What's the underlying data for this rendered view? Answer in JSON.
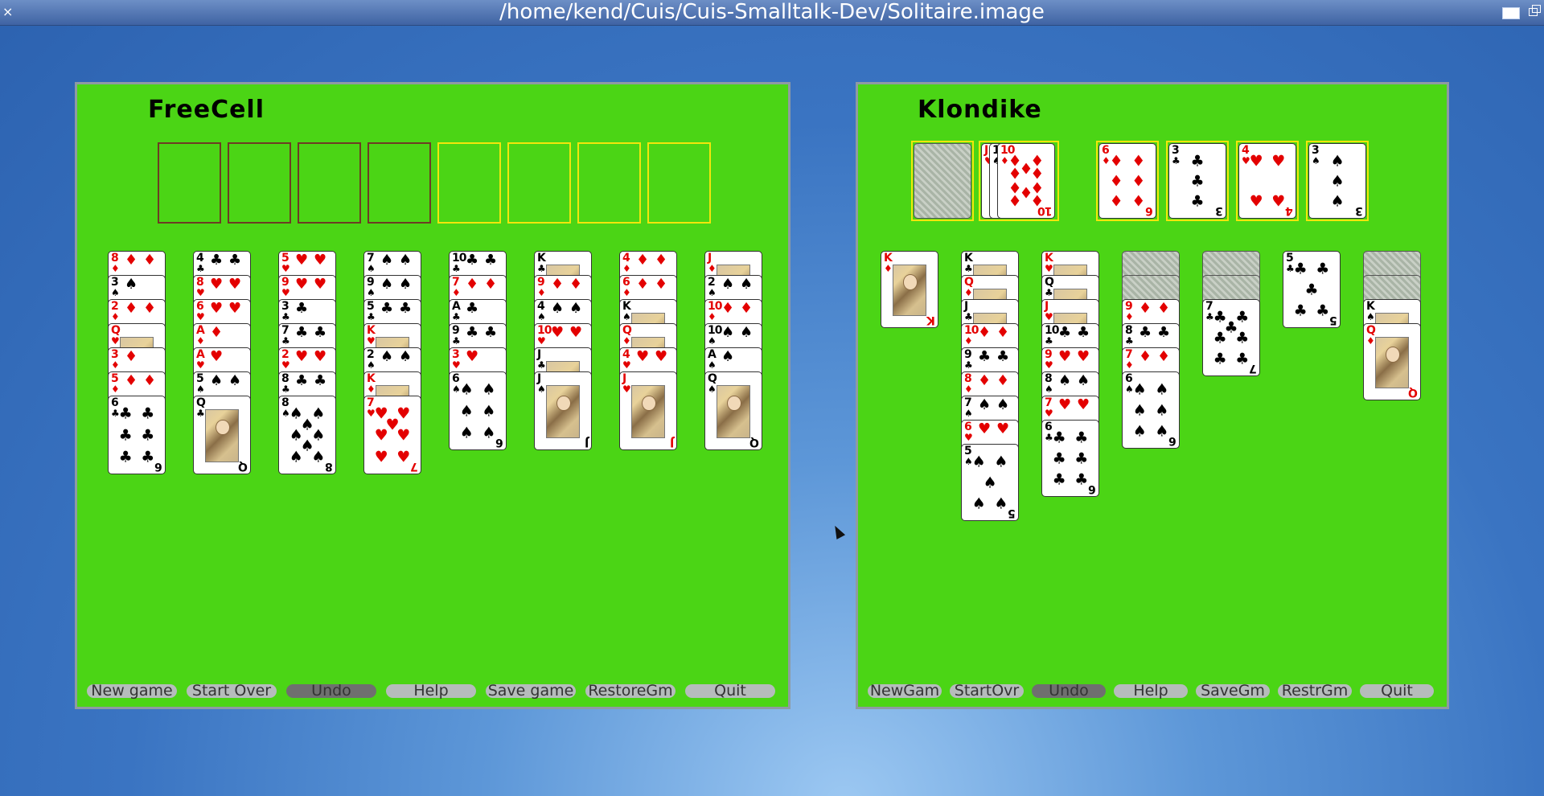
{
  "window": {
    "title": "/home/kend/Cuis/Cuis-Smalltalk-Dev/Solitaire.image",
    "close_glyph": "×"
  },
  "freecell": {
    "title": "FreeCell",
    "free_cells": 4,
    "foundations": 4,
    "columns": [
      [
        [
          "8",
          "♦"
        ],
        [
          "3",
          "♠"
        ],
        [
          "2",
          "♦"
        ],
        [
          "Q",
          "♥"
        ],
        [
          "3",
          "♦"
        ],
        [
          "5",
          "♦"
        ],
        [
          "6",
          "♣"
        ]
      ],
      [
        [
          "4",
          "♣"
        ],
        [
          "8",
          "♥"
        ],
        [
          "6",
          "♥"
        ],
        [
          "A",
          "♦"
        ],
        [
          "A",
          "♥"
        ],
        [
          "5",
          "♠"
        ],
        [
          "Q",
          "♣"
        ]
      ],
      [
        [
          "5",
          "♥"
        ],
        [
          "9",
          "♥"
        ],
        [
          "3",
          "♣"
        ],
        [
          "7",
          "♣"
        ],
        [
          "2",
          "♥"
        ],
        [
          "8",
          "♣"
        ],
        [
          "8",
          "♠"
        ]
      ],
      [
        [
          "7",
          "♠"
        ],
        [
          "9",
          "♠"
        ],
        [
          "5",
          "♣"
        ],
        [
          "K",
          "♥"
        ],
        [
          "2",
          "♠"
        ],
        [
          "K",
          "♦"
        ],
        [
          "7",
          "♥"
        ]
      ],
      [
        [
          "10",
          "♣"
        ],
        [
          "7",
          "♦"
        ],
        [
          "A",
          "♣"
        ],
        [
          "9",
          "♣"
        ],
        [
          "3",
          "♥"
        ],
        [
          "6",
          "♠"
        ]
      ],
      [
        [
          "K",
          "♣"
        ],
        [
          "9",
          "♦"
        ],
        [
          "4",
          "♠"
        ],
        [
          "10",
          "♥"
        ],
        [
          "J",
          "♣"
        ],
        [
          "J",
          "♠"
        ]
      ],
      [
        [
          "4",
          "♦"
        ],
        [
          "6",
          "♦"
        ],
        [
          "K",
          "♠"
        ],
        [
          "Q",
          "♦"
        ],
        [
          "4",
          "♥"
        ],
        [
          "J",
          "♥"
        ]
      ],
      [
        [
          "J",
          "♦"
        ],
        [
          "2",
          "♠"
        ],
        [
          "10",
          "♦"
        ],
        [
          "10",
          "♠"
        ],
        [
          "A",
          "♠"
        ],
        [
          "Q",
          "♠"
        ]
      ]
    ],
    "buttons": [
      "New game",
      "Start Over",
      "Undo",
      "Help",
      "Save game",
      "RestoreGm",
      "Quit"
    ]
  },
  "klondike": {
    "title": "Klondike",
    "waste": [
      [
        "J",
        "♥"
      ],
      [
        "10",
        "♠"
      ],
      [
        "10",
        "♦"
      ]
    ],
    "foundations": [
      [
        "6",
        "♦"
      ],
      [
        "3",
        "♣"
      ],
      [
        "4",
        "♥"
      ],
      [
        "3",
        "♠"
      ]
    ],
    "tableau": [
      {
        "down": 0,
        "up": [
          [
            "K",
            "♦"
          ]
        ]
      },
      {
        "down": 0,
        "up": [
          [
            "K",
            "♣"
          ],
          [
            "Q",
            "♦"
          ],
          [
            "J",
            "♣"
          ],
          [
            "10",
            "♦"
          ],
          [
            "9",
            "♣"
          ],
          [
            "8",
            "♦"
          ],
          [
            "7",
            "♠"
          ],
          [
            "6",
            "♥"
          ],
          [
            "5",
            "♠"
          ]
        ]
      },
      {
        "down": 0,
        "up": [
          [
            "K",
            "♥"
          ],
          [
            "Q",
            "♣"
          ],
          [
            "J",
            "♥"
          ],
          [
            "10",
            "♣"
          ],
          [
            "9",
            "♥"
          ],
          [
            "8",
            "♠"
          ],
          [
            "7",
            "♥"
          ],
          [
            "6",
            "♣"
          ]
        ]
      },
      {
        "down": 2,
        "up": [
          [
            "9",
            "♦"
          ],
          [
            "8",
            "♣"
          ],
          [
            "7",
            "♦"
          ],
          [
            "6",
            "♠"
          ]
        ]
      },
      {
        "down": 2,
        "up": [
          [
            "7",
            "♣"
          ]
        ]
      },
      {
        "down": 0,
        "up": [
          [
            "5",
            "♣"
          ]
        ]
      },
      {
        "down": 2,
        "up": [
          [
            "K",
            "♠"
          ],
          [
            "Q",
            "♦"
          ]
        ]
      }
    ],
    "buttons": [
      "NewGam",
      "StartOvr",
      "Undo",
      "Help",
      "SaveGm",
      "RestrGm",
      "Quit"
    ]
  },
  "colors": {
    "felt": "#4bd515",
    "free_cell_border": "#6e3c24",
    "foundation_border": "#f2e60b",
    "red_suit": "#e30000",
    "button": "#b6bcbc",
    "button_pressed": "#6f6f6f"
  },
  "pressed_button": "Undo"
}
